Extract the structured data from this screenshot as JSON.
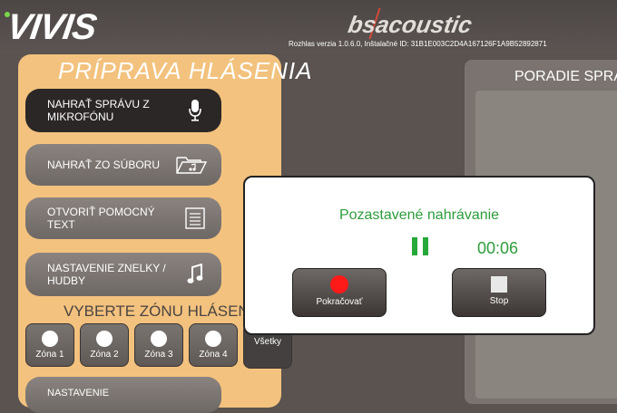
{
  "header": {
    "logo_left": "VIVIS",
    "logo_right": "bsacoustic",
    "version_info": "Rozhlas verzia 1.0.6.0, Inštalačné ID: 31B1E003C2D4A167126F1A9B52892871"
  },
  "left": {
    "title": "PRÍPRAVA HLÁSENIA",
    "buttons": [
      {
        "label": "NAHRAŤ SPRÁVU Z MIKROFÓNU",
        "icon": "microphone-icon"
      },
      {
        "label": "NAHRAŤ ZO SÚBORU",
        "icon": "folder-music-icon"
      },
      {
        "label": "OTVORIŤ POMOCNÝ TEXT",
        "icon": "text-document-icon"
      },
      {
        "label": "NASTAVENIE ZNELKY / HUDBY",
        "icon": "music-note-icon"
      }
    ],
    "zones_title": "VYBERTE ZÓNU HLÁSENIA",
    "zones": [
      "Zóna 1",
      "Zóna 2",
      "Zóna 3",
      "Zóna 4"
    ],
    "zones_all": "Všetky",
    "bottom_button": "NASTAVENIE"
  },
  "right": {
    "title": "PORADIE SPRÁV"
  },
  "dialog": {
    "title": "Pozastavené nahrávanie",
    "timer": "00:06",
    "continue_label": "Pokračovať",
    "stop_label": "Stop"
  },
  "colors": {
    "panel": "#f3c27e",
    "status_green": "#2e9c3c",
    "record_red": "#ff1a1a",
    "dark_button": "#2b2726"
  }
}
